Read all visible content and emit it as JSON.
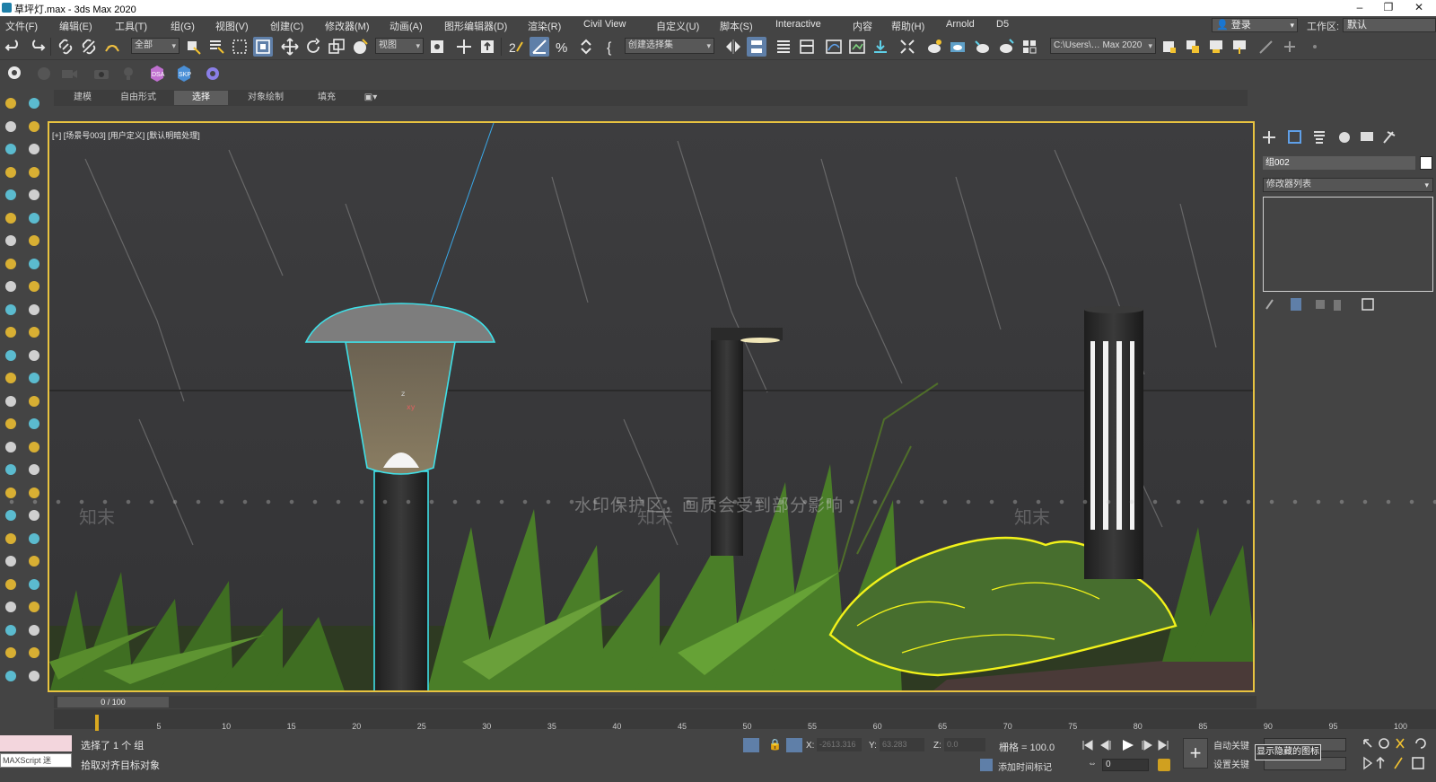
{
  "window": {
    "title": "草坪灯.max - 3ds Max 2020",
    "controls": [
      "–",
      "❐",
      "✕"
    ]
  },
  "menu": [
    "文件(F)",
    "编辑(E)",
    "工具(T)",
    "组(G)",
    "视图(V)",
    "创建(C)",
    "修改器(M)",
    "动画(A)",
    "图形编辑器(D)",
    "渲染(R)",
    "Civil View",
    "自定义(U)",
    "脚本(S)",
    "Interactive",
    "内容",
    "帮助(H)",
    "Arnold",
    "D5"
  ],
  "account": {
    "login": "登录",
    "workspace_label": "工作区:",
    "workspace": "默认"
  },
  "toolbar": {
    "filter": "全部",
    "refcoord": "视图",
    "selset": "创建选择集",
    "path": "C:\\Users\\… Max 2020"
  },
  "ribbon_tabs": [
    "建模",
    "自由形式",
    "选择",
    "对象绘制",
    "填充"
  ],
  "ribbon_active": "选择",
  "viewport": {
    "label": "[+] [场景号003] [用户定义] [默认明暗处理]",
    "watermark": "水印保护区，画质会受到部分影响",
    "watermark_brand": "知末",
    "gizmo_labels": [
      "z",
      "xy"
    ]
  },
  "command_panel": {
    "object_name": "组002",
    "modifier_list": "修改器列表"
  },
  "timeline": {
    "frame_display": "0 / 100",
    "ticks": [
      "0",
      "5",
      "10",
      "15",
      "20",
      "25",
      "30",
      "35",
      "40",
      "45",
      "50",
      "55",
      "60",
      "65",
      "70",
      "75",
      "80",
      "85",
      "90",
      "95",
      "100"
    ]
  },
  "status": {
    "maxscript": "MAXScript 迷",
    "line1": "选择了 1 个 组",
    "line2": "拾取对齐目标对象",
    "x_label": "X:",
    "x_value": "-2613.316",
    "y_label": "Y:",
    "y_value": "63.283",
    "z_label": "Z:",
    "z_value": "0.0",
    "grid": "栅格 = 100.0",
    "add_time_tag": "添加时间标记",
    "auto_key": "自动关键",
    "set_key": "设置关键",
    "tooltip": "显示隐藏的图标",
    "frame": "0"
  },
  "colors": {
    "selection_yellow": "#f2f21a",
    "selection_cyan": "#3fe0e8",
    "viewport_border": "#e8c340",
    "ui_bg": "#444444"
  }
}
